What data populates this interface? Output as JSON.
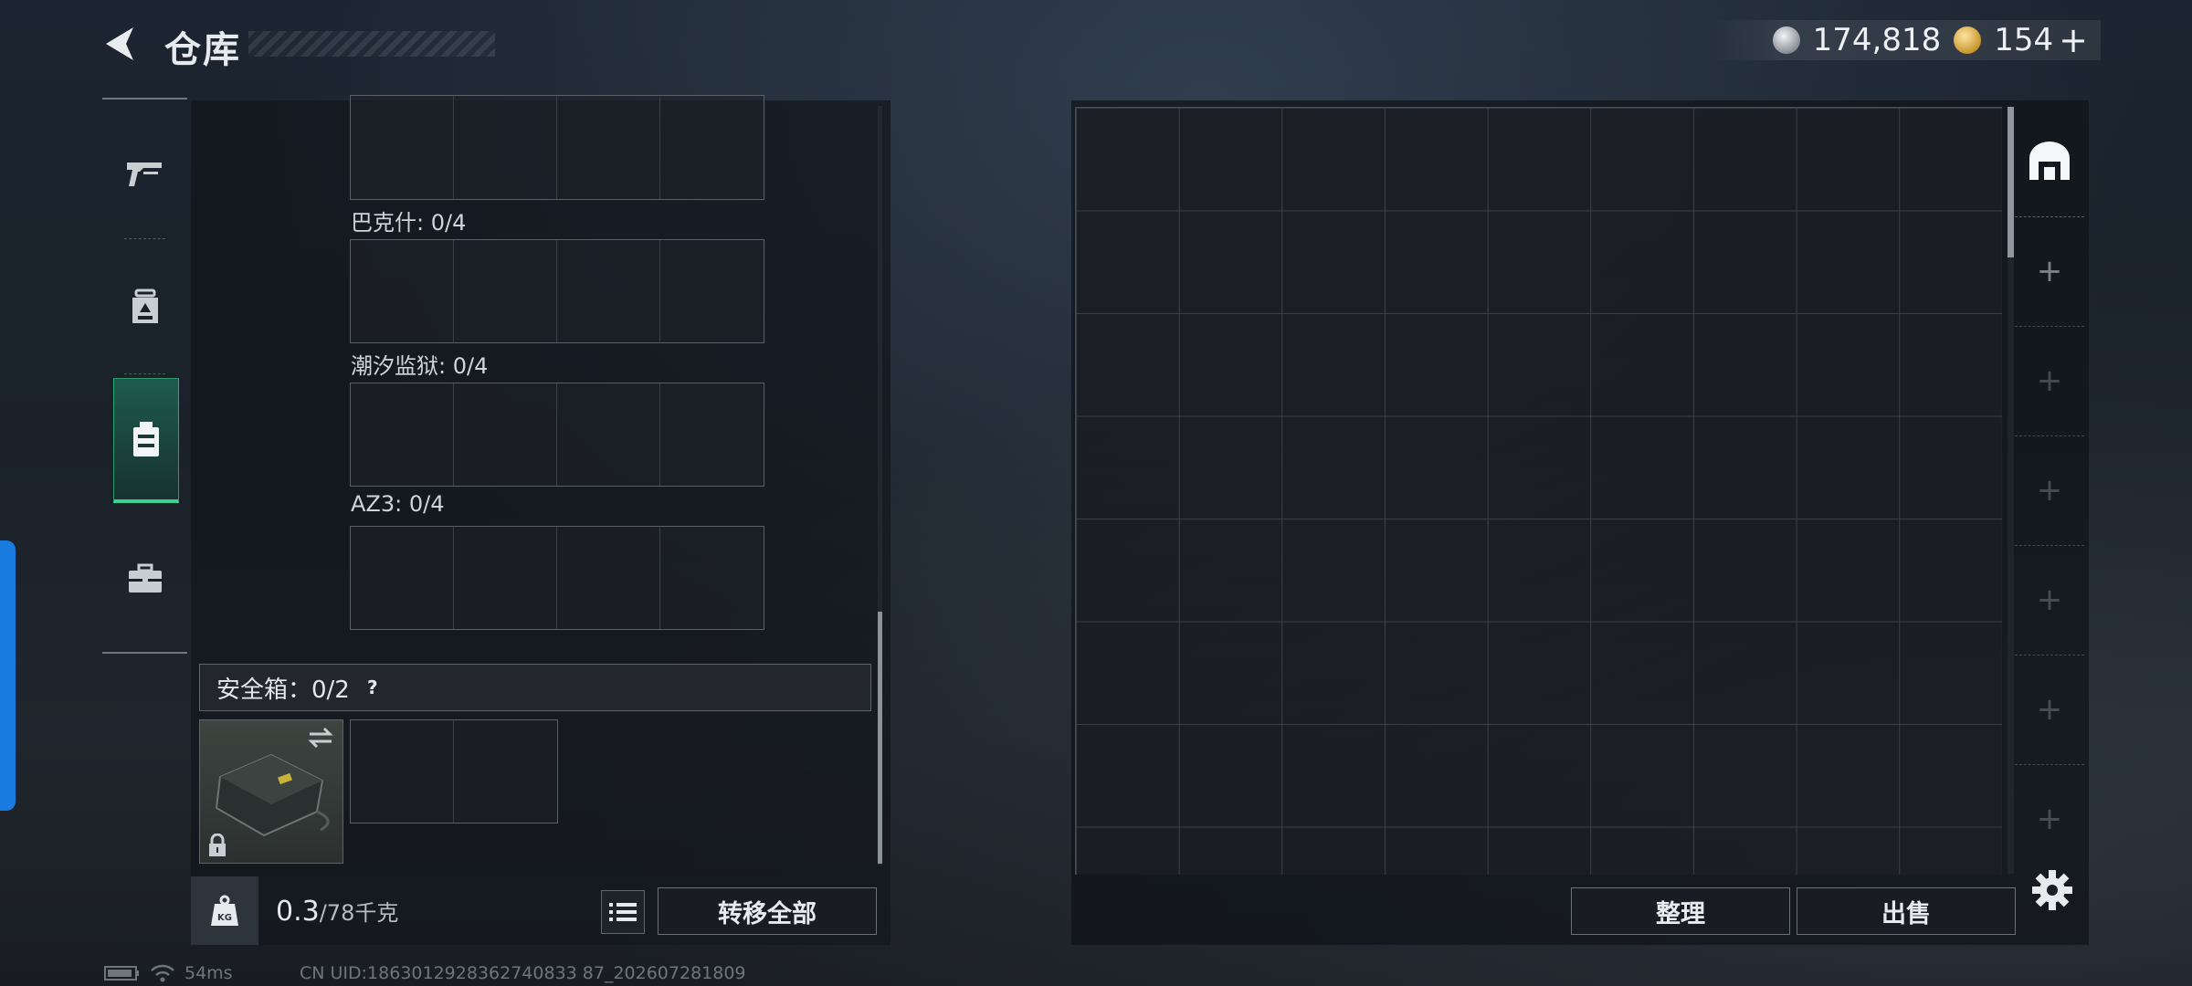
{
  "header": {
    "title": "仓库",
    "back_icon": "back-arrow-icon"
  },
  "currency": [
    {
      "icon": "silver-coin-icon",
      "value": "174,818"
    },
    {
      "icon": "gold-coin-icon",
      "value": "154"
    }
  ],
  "currency_add": "+",
  "sidebar": {
    "items": [
      {
        "icon": "pistol-icon",
        "active": false
      },
      {
        "icon": "backpack-icon",
        "active": false
      },
      {
        "icon": "storage-case-icon",
        "active": true
      },
      {
        "icon": "toolbox-icon",
        "active": false
      }
    ]
  },
  "storage": {
    "labels": [
      "巴克什: 0/4",
      "潮汐监狱: 0/4",
      "AZ3: 0/4"
    ],
    "safe_box": {
      "label": "安全箱：0/2",
      "help": "?"
    },
    "weight_value": "0.3",
    "weight_max": "/78千克",
    "transfer_all_label": "转移全部"
  },
  "right": {
    "organize_label": "整理",
    "sell_label": "出售",
    "tabs": [
      "home-icon",
      "+",
      "+",
      "+",
      "+",
      "+",
      "+"
    ]
  },
  "status": {
    "ping": "54ms",
    "uid": "CN UID:1863012928362740833 87_202607281809"
  },
  "colors": {
    "accent": "#39d48f",
    "edge_tab": "#1a7be0"
  }
}
